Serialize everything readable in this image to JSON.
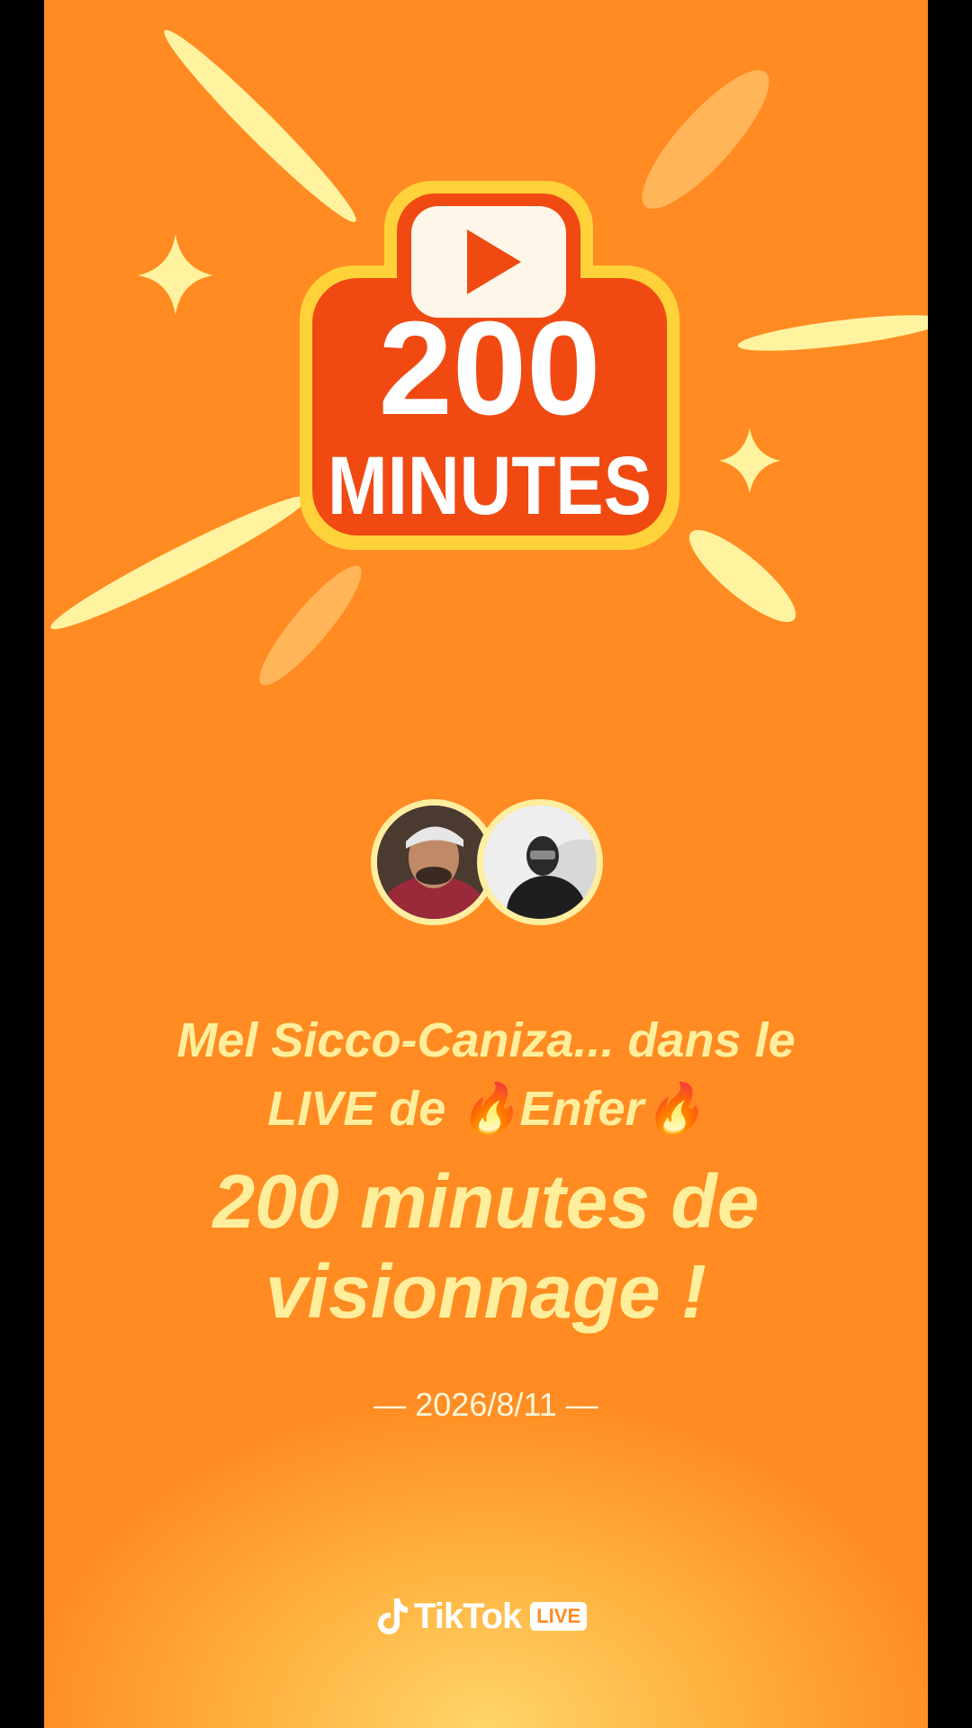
{
  "badge": {
    "number": "200",
    "word": "MINUTES",
    "play_icon": "play-icon"
  },
  "viewers": [
    {
      "name": "viewer-avatar-1"
    },
    {
      "name": "viewer-avatar-2"
    }
  ],
  "message": {
    "line1": "Mel Sicco-Caniza... dans le",
    "line2": "LIVE de 🔥Enfer🔥",
    "highlight1": "200 minutes de",
    "highlight2": "visionnage !"
  },
  "date": "— 2026/8/11 —",
  "brand": {
    "name": "TikTok",
    "tag": "LIVE",
    "logo_icon": "tiktok-note-icon"
  },
  "colors": {
    "background": "#ff8b22",
    "text_yellow": "#ffef9c",
    "badge_red": "#f04a12",
    "badge_yellow": "#ffd23a"
  }
}
